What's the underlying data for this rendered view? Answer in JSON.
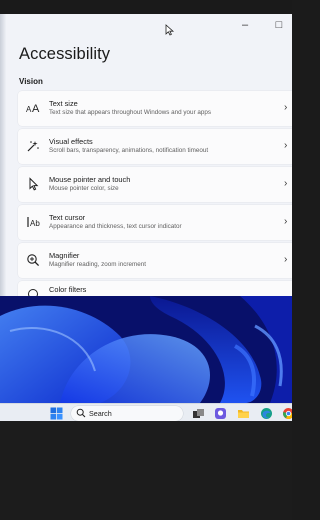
{
  "window": {
    "minimize_label": "–",
    "maximize_label": "□"
  },
  "page": {
    "title": "Accessibility",
    "section": "Vision"
  },
  "items": [
    {
      "name": "Text size",
      "desc": "Text size that appears throughout Windows and your apps",
      "icon": "text-size-icon"
    },
    {
      "name": "Visual effects",
      "desc": "Scroll bars, transparency, animations, notification timeout",
      "icon": "visual-effects-icon"
    },
    {
      "name": "Mouse pointer and touch",
      "desc": "Mouse pointer color, size",
      "icon": "mouse-pointer-icon"
    },
    {
      "name": "Text cursor",
      "desc": "Appearance and thickness, text cursor indicator",
      "icon": "text-cursor-icon"
    },
    {
      "name": "Magnifier",
      "desc": "Magnifier reading, zoom increment",
      "icon": "magnifier-icon"
    },
    {
      "name": "Color filters",
      "desc": "",
      "icon": "color-filters-icon"
    }
  ],
  "chevron": "›",
  "taskbar": {
    "search_label": "Search",
    "icons": [
      "start-icon",
      "search-icon",
      "task-view-icon",
      "chat-icon",
      "file-explorer-icon",
      "edge-icon",
      "chrome-icon"
    ]
  },
  "colors": {
    "window_bg": "#f1f3f8",
    "card_bg": "#fbfbfc",
    "taskbar_bg": "#e9edf3",
    "wallpaper": "#0a18a0"
  }
}
